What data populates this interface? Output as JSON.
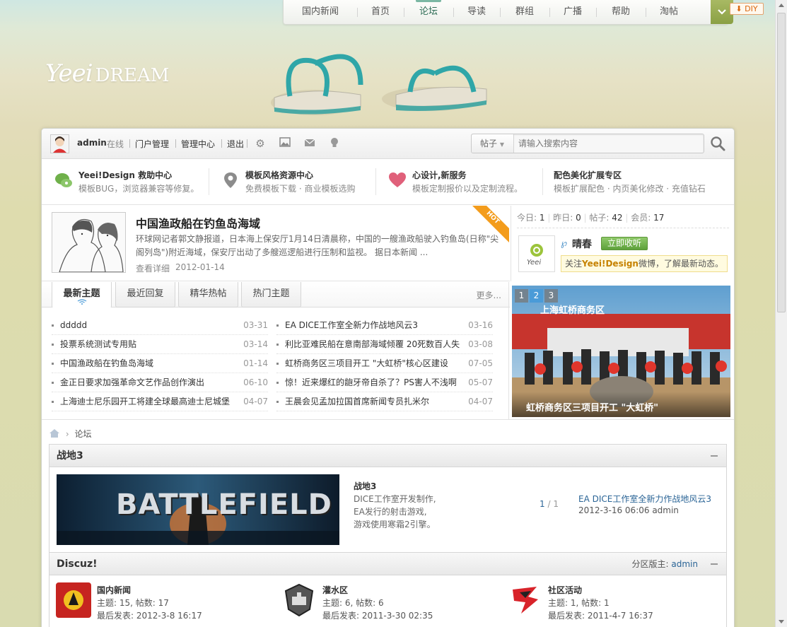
{
  "nav": {
    "items": [
      "国内新闻",
      "首页",
      "论坛",
      "导读",
      "群组",
      "广播",
      "帮助",
      "淘帖"
    ],
    "active_index": 2,
    "diy_label": "DIY"
  },
  "logo": {
    "main": "Yeei",
    "sub": "DREAM"
  },
  "userbar": {
    "username": "admin",
    "status": "在线",
    "links": [
      "门户管理",
      "管理中心",
      "退出"
    ],
    "search_type": "帖子",
    "search_placeholder": "请输入搜索内容"
  },
  "services": [
    {
      "title": "Yeei!Design 救助中心",
      "desc": "模板BUG，浏览器兼容等修复。",
      "icon": "chat-bubble-icon",
      "color": "#6fb04a"
    },
    {
      "title": "模板风格资源中心",
      "desc": "免费模板下载 · 商业模板选购",
      "icon": "location-pin-icon",
      "color": "#8c8c8c"
    },
    {
      "title": "心设计,新服务",
      "desc": "模板定制报价以及定制流程。",
      "icon": "heart-icon",
      "color": "#e0607a"
    },
    {
      "title": "配色美化扩展专区",
      "desc": "模板扩展配色 · 内页美化修改 · 充值钻石",
      "icon": "",
      "color": ""
    }
  ],
  "headline": {
    "title": "中国渔政船在钓鱼岛海域",
    "desc": "环球网记者郭文静报道，日本海上保安厅1月14日清晨称，中国的一艘渔政船驶入钓鱼岛(日称\"尖阁列岛\")附近海域，保安厅出动了多艘巡逻船进行压制和监视。 据日本新闻 ...",
    "more": "查看详细",
    "date": "2012-01-14",
    "badge": "HOT"
  },
  "stats": {
    "today_label": "今日:",
    "today": "1",
    "yesterday_label": "昨日:",
    "yesterday": "0",
    "posts_label": "帖子:",
    "posts": "42",
    "members_label": "会员:",
    "members": "17"
  },
  "weibo": {
    "name": "晴春",
    "follow": "立即收听",
    "note_pre": "关注",
    "note_brand": "Yeei!Design",
    "note_post": "微博，了解最新动态。",
    "logo_text": "Yeei"
  },
  "tabs": {
    "items": [
      "最新主题",
      "最近回复",
      "精华热帖",
      "热门主题"
    ],
    "active_index": 0,
    "more": "更多..."
  },
  "threads_left": [
    {
      "title": "ddddd",
      "date": "03-31"
    },
    {
      "title": "投票系统测试专用贴",
      "date": "03-14"
    },
    {
      "title": "中国渔政船在钓鱼岛海域",
      "date": "01-14"
    },
    {
      "title": "金正日要求加强革命文艺作品创作演出",
      "date": "06-10"
    },
    {
      "title": "上海迪士尼乐园开工将建全球最高迪士尼城堡",
      "date": "04-07"
    }
  ],
  "threads_right": [
    {
      "title": "EA DICE工作室全新力作战地风云3",
      "date": "03-16"
    },
    {
      "title": "利比亚难民船在意南部海域倾覆 20死数百人失",
      "date": "03-08"
    },
    {
      "title": "虹桥商务区三项目开工 \"大虹桥\"核心区建设",
      "date": "07-05"
    },
    {
      "title": "惊！近来爆红的龅牙帝自杀了？PS害人不浅啊",
      "date": "05-07"
    },
    {
      "title": "王晨会见孟加拉国首席新闻专员扎米尔",
      "date": "04-07"
    }
  ],
  "slider": {
    "pages": [
      "1",
      "2",
      "3"
    ],
    "active_index": 1,
    "banner": "上海虹桥商务区",
    "caption": "虹桥商务区三项目开工 \"大虹桥\""
  },
  "breadcrumb": {
    "current": "论坛"
  },
  "categories": [
    {
      "name": "战地3",
      "banner_text": "BATTLEFIELD",
      "forum_title": "战地3",
      "forum_desc": [
        "DICE工作室开发制作,",
        "EA发行的射击游戏,",
        "游戏使用寒霜2引擎。"
      ],
      "pages": "1",
      "pages_sep": "/",
      "pages_total": "1",
      "last_title": "EA DICE工作室全新力作战地风云3",
      "last_info": "2012-3-16 06:06 admin"
    },
    {
      "name": "Discuz!",
      "mod_label": "分区版主:",
      "mod_name": "admin",
      "forums": [
        {
          "name": "国内新闻",
          "stats": "主题: 15, 帖数: 17",
          "last": "最后发表: 2012-3-8 16:17"
        },
        {
          "name": "灌水区",
          "stats": "主题: 6, 帖数: 6",
          "last": "最后发表: 2011-3-30 02:35"
        },
        {
          "name": "社区活动",
          "stats": "主题: 1, 帖数: 1",
          "last": "最后发表: 2011-4-7 16:37"
        }
      ]
    }
  ]
}
